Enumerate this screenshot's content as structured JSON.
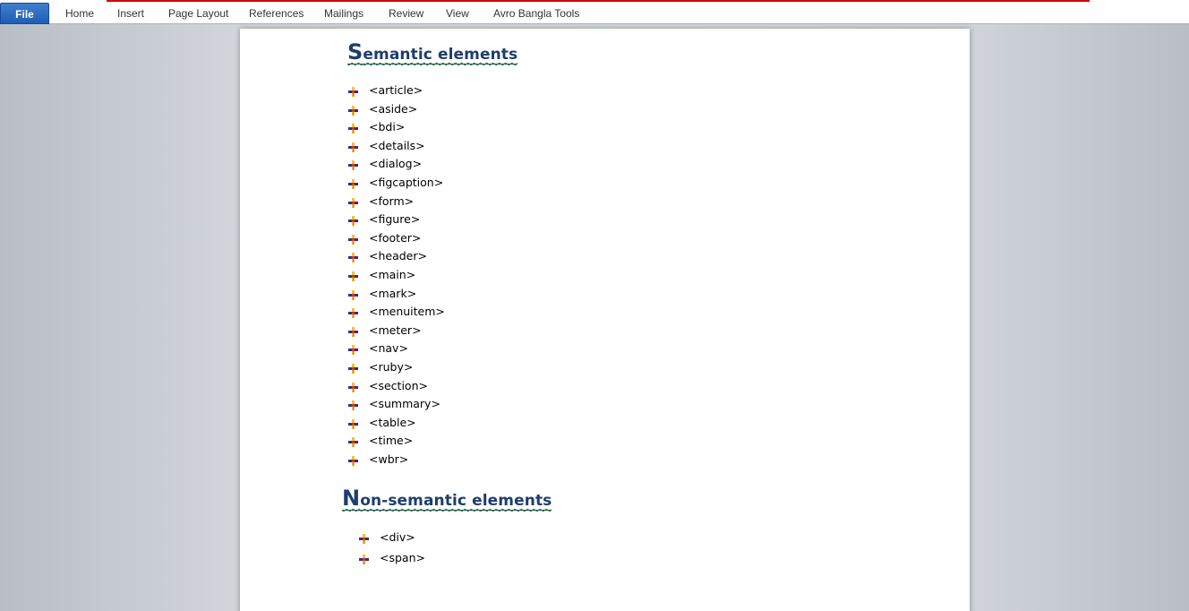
{
  "ribbon": {
    "file": "File",
    "tabs": [
      "Home",
      "Insert",
      "Page Layout",
      "References",
      "Mailings",
      "Review",
      "View",
      "Avro Bangla Tools"
    ]
  },
  "document": {
    "heading1_cap": "S",
    "heading1_rest": "emantic elements",
    "semantic_items": [
      "<article>",
      "<aside>",
      "<bdi>",
      "<details>",
      "<dialog>",
      "<figcaption>",
      "<form>",
      "<figure>",
      "<footer>",
      "<header>",
      "<main>",
      "<mark>",
      "<menuitem>",
      "<meter>",
      "<nav>",
      "<ruby>",
      "<section>",
      "<summary>",
      "<table>",
      "<time>",
      "<wbr>"
    ],
    "heading2_cap": "N",
    "heading2_rest": "on-semantic elements",
    "nonsemantic_items": [
      "<div>",
      "<span>"
    ]
  },
  "colors": {
    "heading": "#1f3d6b",
    "file_tab": "#2a6bc4",
    "accent_line": "#d40000"
  }
}
